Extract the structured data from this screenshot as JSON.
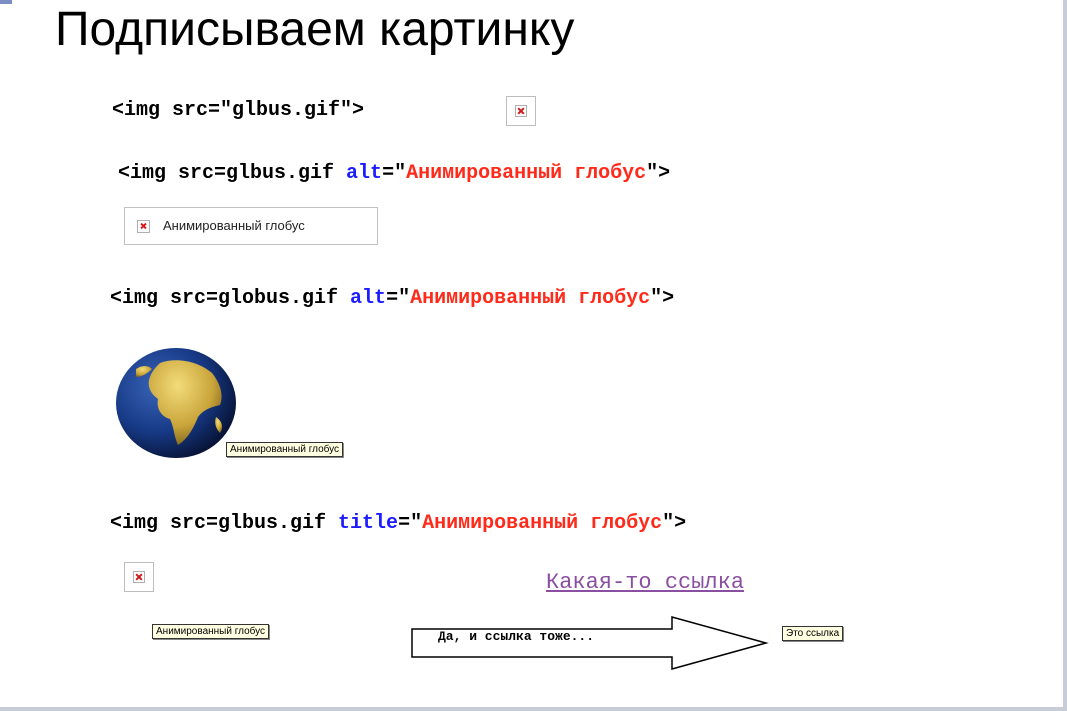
{
  "title": "Подписываем картинку",
  "line1": {
    "code": "<img src=\"glbus.gif\">"
  },
  "line2": {
    "pre": "<img src=glbus.gif ",
    "attr": "alt",
    "eq": "=\"",
    "value": "Анимированный глобус",
    "post": "\">"
  },
  "alt_box": {
    "text": "Анимированный глобус"
  },
  "line3": {
    "pre": "<img src=globus.gif ",
    "attr": "alt",
    "eq": "=\"",
    "value": "Анимированный глобус",
    "post": "\">"
  },
  "globe_tooltip": "Анимированный глобус",
  "line4": {
    "pre": "<img src=glbus.gif ",
    "attr": "title",
    "eq": "=\"",
    "value": "Анимированный глобус",
    "post": "\">"
  },
  "title_tooltip": "Анимированный глобус",
  "link": {
    "text": "Какая-то ссылка"
  },
  "arrow_text": "Да, и ссылка тоже...",
  "link_tooltip": "Это ссылка",
  "colors": {
    "attribute": "#1c1cff",
    "string": "#ff2a1a",
    "link": "#8a4fa0",
    "tooltip_bg": "#ffffe1"
  }
}
